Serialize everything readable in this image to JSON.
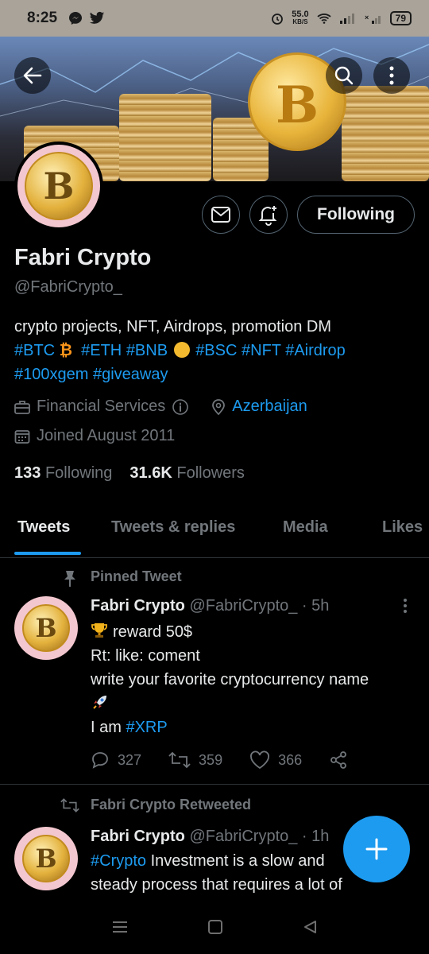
{
  "status_bar": {
    "time": "8:25",
    "net_speed_value": "55.0",
    "net_speed_unit": "KB/S",
    "battery": "79"
  },
  "profile": {
    "name": "Fabri Crypto",
    "handle": "@FabriCrypto_",
    "bio_line1": "crypto projects, NFT, Airdrops, promotion DM",
    "bio_tag_btc": "#BTC",
    "bio_tag_eth": "#ETH",
    "bio_tag_bnb": "#BNB",
    "bio_tag_bsc": "#BSC",
    "bio_tag_nft": "#NFT",
    "bio_tag_airdrop": "#Airdrop",
    "bio_tag_100xgem": "#100xgem",
    "bio_tag_giveaway": "#giveaway",
    "category": "Financial Services",
    "location": "Azerbaijan",
    "joined": "Joined August 2011",
    "following_count": "133",
    "following_label": "Following",
    "followers_count": "31.6K",
    "followers_label": "Followers",
    "follow_button": "Following"
  },
  "tabs": [
    "Tweets",
    "Tweets & replies",
    "Media",
    "Likes"
  ],
  "pinned_tweet": {
    "label": "Pinned Tweet",
    "author": "Fabri Crypto",
    "meta": "@FabriCrypto_ · 5h",
    "line1": "reward 50$",
    "line2": "Rt: like: coment",
    "line3": "write your favorite cryptocurrency name",
    "line5_text": "I am ",
    "line5_tag": "#XRP",
    "replies": "327",
    "retweets": "359",
    "likes": "366"
  },
  "retweet": {
    "label": "Fabri Crypto Retweeted",
    "author": "Fabri Crypto",
    "meta": "@FabriCrypto_ · 1h",
    "tag": "#Crypto",
    "line1_rest": " Investment is a slow and",
    "line2": "steady process that requires a lot of"
  },
  "colors": {
    "accent": "#1d9bf0",
    "muted": "#71767b",
    "background": "#000000"
  },
  "icons": [
    "back-arrow-icon",
    "search-icon",
    "more-vertical-icon",
    "mail-icon",
    "notification-bell-icon",
    "briefcase-icon",
    "info-icon",
    "location-pin-icon",
    "calendar-icon",
    "pin-icon",
    "reply-icon",
    "retweet-icon",
    "heart-icon",
    "share-icon",
    "plus-icon"
  ]
}
